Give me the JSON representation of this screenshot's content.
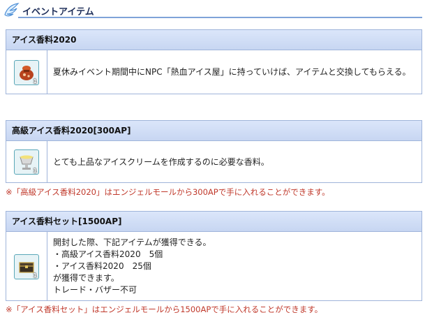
{
  "section": {
    "title": "イベントアイテム",
    "icon": "wing-icon"
  },
  "items": [
    {
      "name": "アイス香料2020",
      "icon": "spice-bag-icon",
      "qty": "1",
      "desc": "夏休みイベント期間中にNPC「熱血アイス屋」に持っていけば、アイテムと交換してもらえる。"
    },
    {
      "name": "高級アイス香料2020[300AP]",
      "icon": "silver-cup-icon",
      "qty": "1",
      "desc": "とても上品なアイスクリームを作成するのに必要な香料。",
      "note": "※「高級アイス香料2020」はエンジェルモールから300APで手に入れることができます。"
    },
    {
      "name": "アイス香料セット[1500AP]",
      "icon": "treasure-box-icon",
      "qty": "1",
      "desc_lines": [
        "開封した際、下記アイテムが獲得できる。",
        "・高級アイス香料2020　5個",
        "・アイス香料2020　25個",
        "が獲得できます。",
        "トレード・バザー不可"
      ],
      "note": "※「アイス香料セット」はエンジェルモールから1500APで手に入れることができます。"
    }
  ],
  "colors": {
    "accent": "#7fa3d8",
    "note": "#c0392b",
    "header_bg": "#c7d6f2"
  }
}
